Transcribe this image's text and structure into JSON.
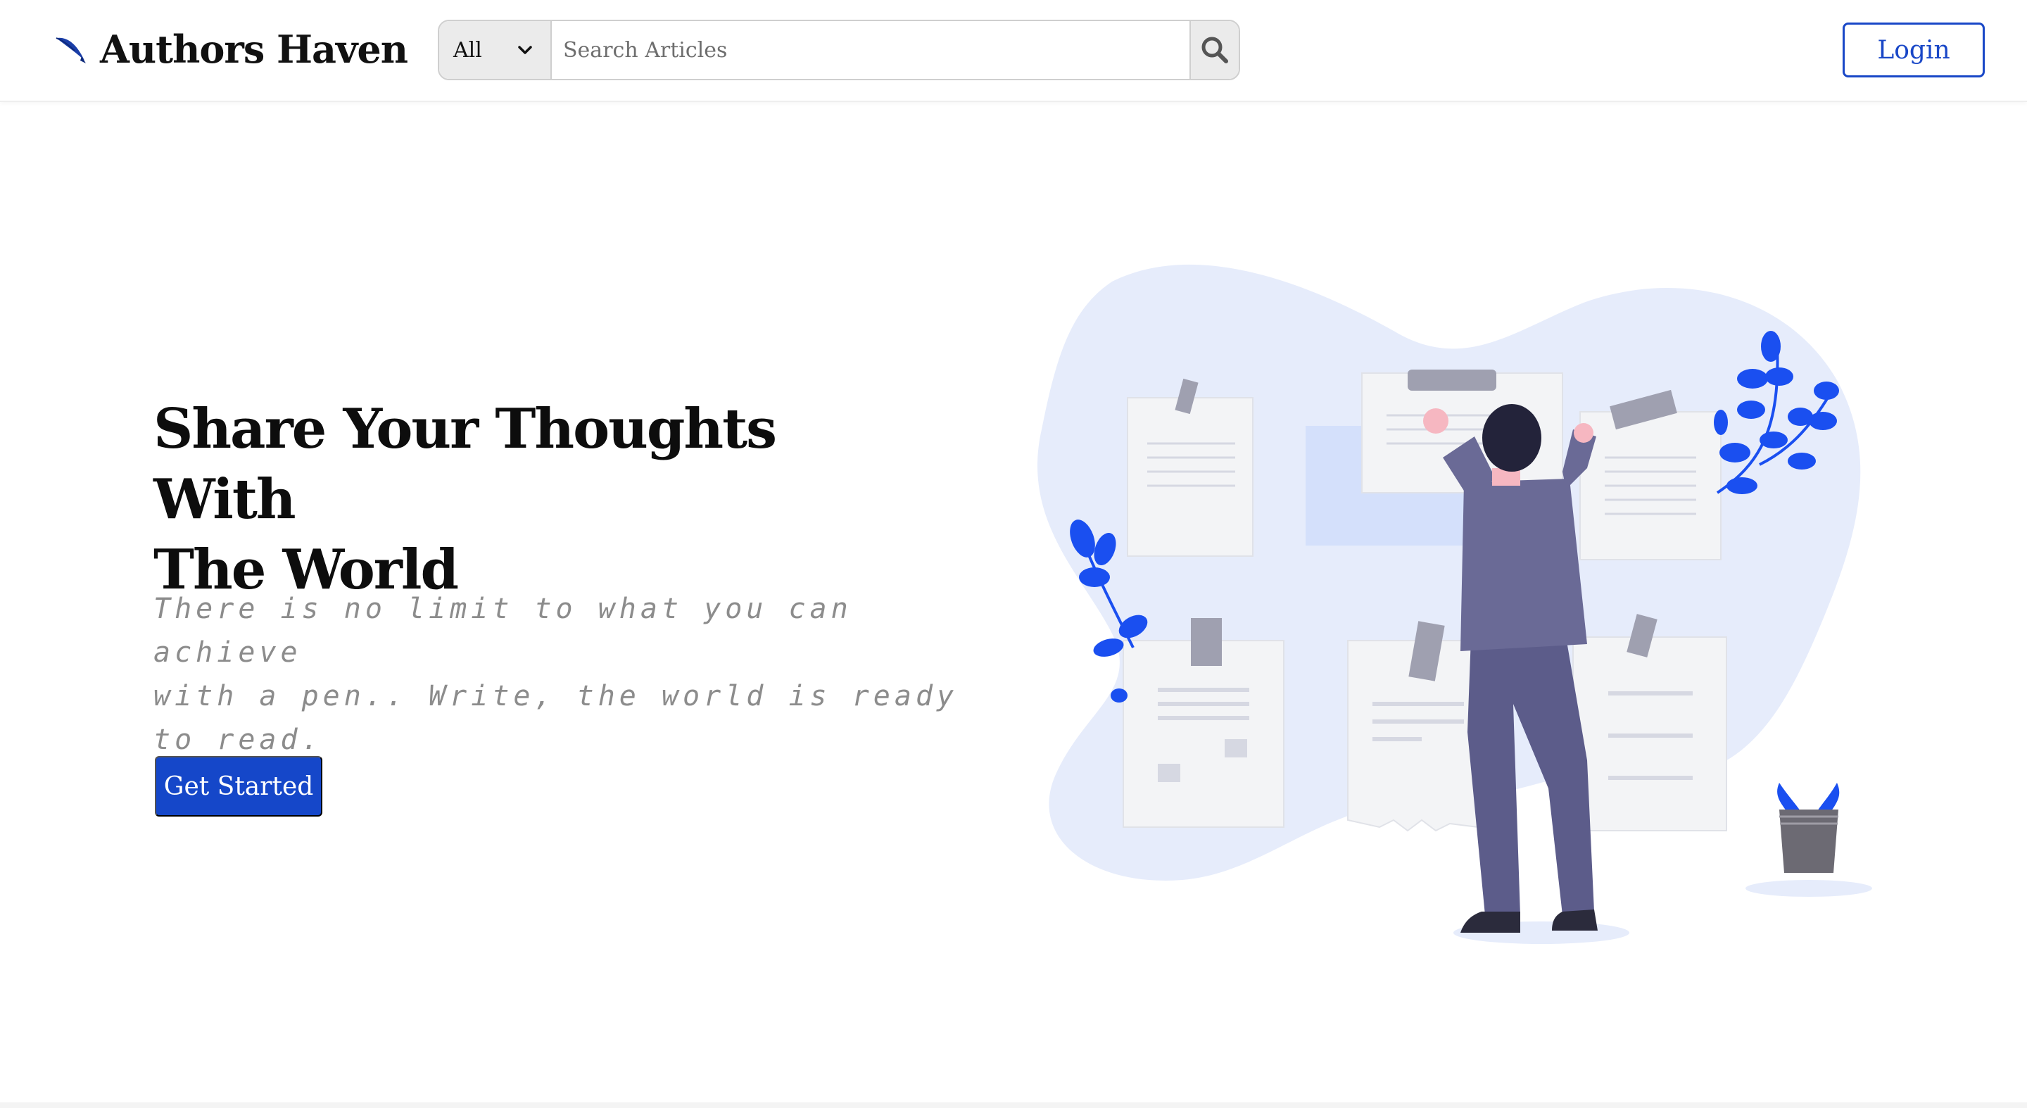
{
  "header": {
    "brand": "Authors Haven",
    "brand_icon": "quill-pen-icon",
    "search": {
      "category_selected": "All",
      "placeholder": "Search Articles",
      "button_icon": "search-icon"
    },
    "login_label": "Login"
  },
  "hero": {
    "title_line1": "Share Your Thoughts With",
    "title_line2": "The World",
    "subtitle_line1": "There is no limit to what you can achieve",
    "subtitle_line2": "with a pen.. Write, the world is ready to read.",
    "cta_label": "Get Started",
    "illustration": "man-pinning-documents-illustration"
  },
  "colors": {
    "primary": "#1547c9",
    "blob": "#e6ecfb",
    "leaf": "#1a4ff0",
    "suit": "#5c5c8a",
    "paper": "#f3f4f6"
  }
}
